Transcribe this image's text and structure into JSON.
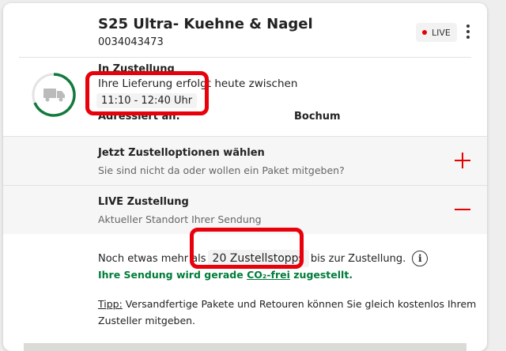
{
  "header": {
    "title": "S25 Ultra- Kuehne & Nagel",
    "tracking_number": "0034043473",
    "live_badge": "LIVE"
  },
  "status": {
    "heading": "In Zustellung",
    "line": "Ihre Lieferung erfolgt heute zwischen",
    "time_window": "11:10 - 12:40 Uhr",
    "address_label": "Adressiert an:",
    "address_city": "Bochum",
    "icon": "delivery-truck-icon"
  },
  "options_section": {
    "title": "Jetzt Zustelloptionen wählen",
    "subtitle": "Sie sind nicht da oder wollen ein Paket mitgeben?",
    "expand_icon": "plus-icon"
  },
  "live_section": {
    "title": "LIVE Zustellung",
    "subtitle": "Aktueller Standort Ihrer Sendung",
    "collapse_icon": "minus-icon",
    "stops_prefix": "Noch etwas mehr als",
    "stops_value": "20 Zustellstopps",
    "stops_suffix": "bis zur Zustellung.",
    "green_prefix": "Ihre Sendung wird gerade",
    "green_link": "CO₂-frei",
    "green_suffix": "zugestellt.",
    "tip_label": "Tipp:",
    "tip_text": "Versandfertige Pakete und Retouren können Sie gleich kostenlos Ihrem Zusteller mitgeben."
  },
  "colors": {
    "accent_red": "#e60000",
    "green": "#007c3a"
  }
}
